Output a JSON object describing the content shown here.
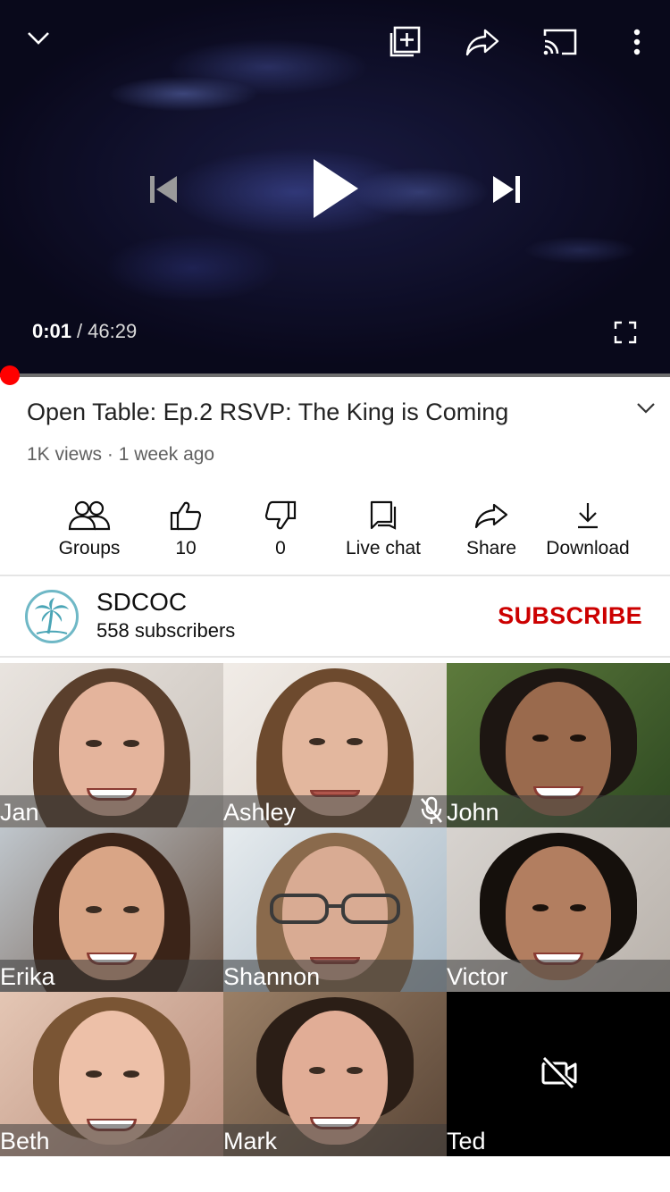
{
  "player": {
    "current_time": "0:01",
    "separator": "/",
    "duration": "46:29",
    "progress_fraction": 0.0004,
    "icons": {
      "minimize": "chevron-down-icon",
      "add_to_playlist": "add-to-playlist-icon",
      "share": "share-icon",
      "cast": "cast-icon",
      "more": "more-vert-icon",
      "previous": "skip-previous-icon",
      "play": "play-icon",
      "next": "skip-next-icon",
      "fullscreen": "fullscreen-icon"
    }
  },
  "video": {
    "title": "Open Table: Ep.2 RSVP: The King is Coming",
    "meta": "1K views · 1 week ago"
  },
  "actions": [
    {
      "label": "Groups",
      "icon": "groups-icon"
    },
    {
      "label": "10",
      "icon": "thumbs-up-icon"
    },
    {
      "label": "0",
      "icon": "thumbs-down-icon"
    },
    {
      "label": "Live chat",
      "icon": "chat-icon"
    },
    {
      "label": "Share",
      "icon": "share-icon"
    },
    {
      "label": "Download",
      "icon": "download-icon"
    }
  ],
  "channel": {
    "name": "SDCOC",
    "subscribers": "558 subscribers",
    "subscribe_label": "SUBSCRIBE",
    "avatar_icon": "palm-tree-icon"
  },
  "participants": [
    {
      "name": "Jan",
      "muted": false,
      "camera_on": true
    },
    {
      "name": "Ashley",
      "muted": false,
      "camera_on": true
    },
    {
      "name": "John",
      "muted": true,
      "camera_on": true
    },
    {
      "name": "Erika",
      "muted": false,
      "camera_on": true
    },
    {
      "name": "Shannon",
      "muted": false,
      "camera_on": true
    },
    {
      "name": "Victor",
      "muted": false,
      "camera_on": true
    },
    {
      "name": "Beth",
      "muted": false,
      "camera_on": true
    },
    {
      "name": "Mark",
      "muted": false,
      "camera_on": true
    },
    {
      "name": "Ted",
      "muted": false,
      "camera_on": false
    }
  ],
  "colors": {
    "accent_red": "#ff0000",
    "subscribe_red": "#cc0000",
    "text_primary": "#0f0f0f",
    "text_secondary": "#606060"
  }
}
